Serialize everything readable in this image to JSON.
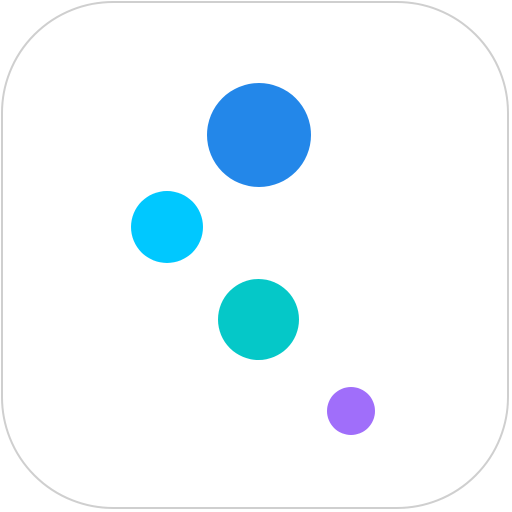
{
  "icon": {
    "name": "app-icon-dots",
    "border_color": "#cfcfcf",
    "background_color": "#ffffff"
  },
  "dots": [
    {
      "name": "blue-dot-icon",
      "color": "#2387e9"
    },
    {
      "name": "cyan-dot-icon",
      "color": "#00c8ff"
    },
    {
      "name": "teal-dot-icon",
      "color": "#05c8c8"
    },
    {
      "name": "purple-dot-icon",
      "color": "#a06efa"
    }
  ]
}
